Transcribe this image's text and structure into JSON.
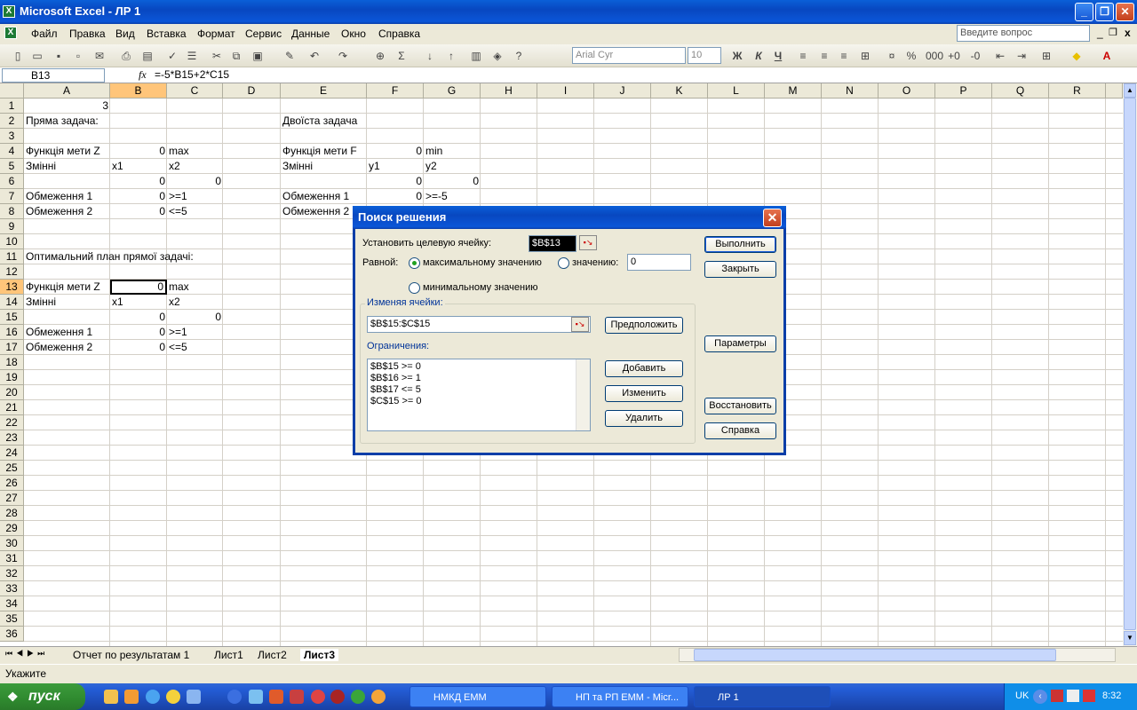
{
  "window": {
    "title": "Microsoft Excel - ЛР 1"
  },
  "menu": {
    "items": [
      "Файл",
      "Правка",
      "Вид",
      "Вставка",
      "Формат",
      "Сервис",
      "Данные",
      "Окно",
      "Справка"
    ],
    "help_placeholder": "Введите вопрос"
  },
  "toolbar": {
    "font": "Arial Cyr",
    "size": "10"
  },
  "formula_bar": {
    "name_box": "B13",
    "fx": "fx",
    "formula": "=-5*B15+2*C15"
  },
  "columns": [
    "A",
    "B",
    "C",
    "D",
    "E",
    "F",
    "G",
    "H",
    "I",
    "J",
    "K",
    "L",
    "M",
    "N",
    "O",
    "P",
    "Q",
    "R"
  ],
  "rows": [
    "1",
    "2",
    "3",
    "4",
    "5",
    "6",
    "7",
    "8",
    "9",
    "10",
    "11",
    "12",
    "13",
    "14",
    "15",
    "16",
    "17",
    "18",
    "19",
    "20",
    "21",
    "22",
    "23",
    "24",
    "25",
    "26",
    "27",
    "28",
    "29",
    "30",
    "31",
    "32",
    "33",
    "34",
    "35",
    "36"
  ],
  "cells": {
    "a1": "3",
    "a2": "Пряма задача:",
    "e2": "Двоїста задача",
    "a4": "Функція мети Z",
    "b4": "0",
    "c4": "max",
    "e4": "Функція мети F",
    "f4": "0",
    "g4": "min",
    "a5": "Змінні",
    "b5": "x1",
    "c5": "x2",
    "e5": "Змінні",
    "f5": "y1",
    "g5": "y2",
    "b6": "0",
    "c6": "0",
    "f6": "0",
    "g6": "0",
    "a7": "Обмеження 1",
    "b7": "0",
    "c7": ">=1",
    "e7": "Обмеження 1",
    "f7": "0",
    "g7": ">=-5",
    "a8": "Обмеження 2",
    "b8": "0",
    "c8": "<=5",
    "e8": "Обмеження 2",
    "a11": "Оптимальний план прямої задачі:",
    "a13": "Функція мети Z",
    "b13": "0",
    "c13": "max",
    "a14": "Змінні",
    "b14": "x1",
    "c14": "x2",
    "b15": "0",
    "c15": "0",
    "a16": "Обмеження 1",
    "b16": "0",
    "c16": ">=1",
    "a17": "Обмеження 2",
    "b17": "0",
    "c17": "<=5"
  },
  "sheet_tabs": [
    "Отчет по результатам 1",
    "Лист1",
    "Лист2",
    "Лист3"
  ],
  "active_sheet": "Лист3",
  "status": "Укажите",
  "dialog": {
    "title": "Поиск решения",
    "target_label": "Установить целевую ячейку:",
    "target_value": "$B$13",
    "equal_label": "Равной:",
    "opt_max": "максимальному значению",
    "opt_value": "значению:",
    "value_field": "0",
    "opt_min": "минимальному значению",
    "changing_label": "Изменяя ячейки:",
    "changing_value": "$B$15:$C$15",
    "guess": "Предположить",
    "constraints_label": "Ограничения:",
    "constraints": [
      "$B$15 >= 0",
      "$B$16 >= 1",
      "$B$17 <= 5",
      "$C$15 >= 0"
    ],
    "add": "Добавить",
    "change": "Изменить",
    "delete": "Удалить",
    "solve": "Выполнить",
    "close": "Закрыть",
    "options": "Параметры",
    "reset": "Восстановить",
    "help": "Справка"
  },
  "taskbar": {
    "start": "пуск",
    "tasks": [
      "НМКД ЕММ",
      "НП та РП ЕММ - Micr...",
      "ЛР 1"
    ],
    "lang": "UK",
    "time": "8:32"
  }
}
